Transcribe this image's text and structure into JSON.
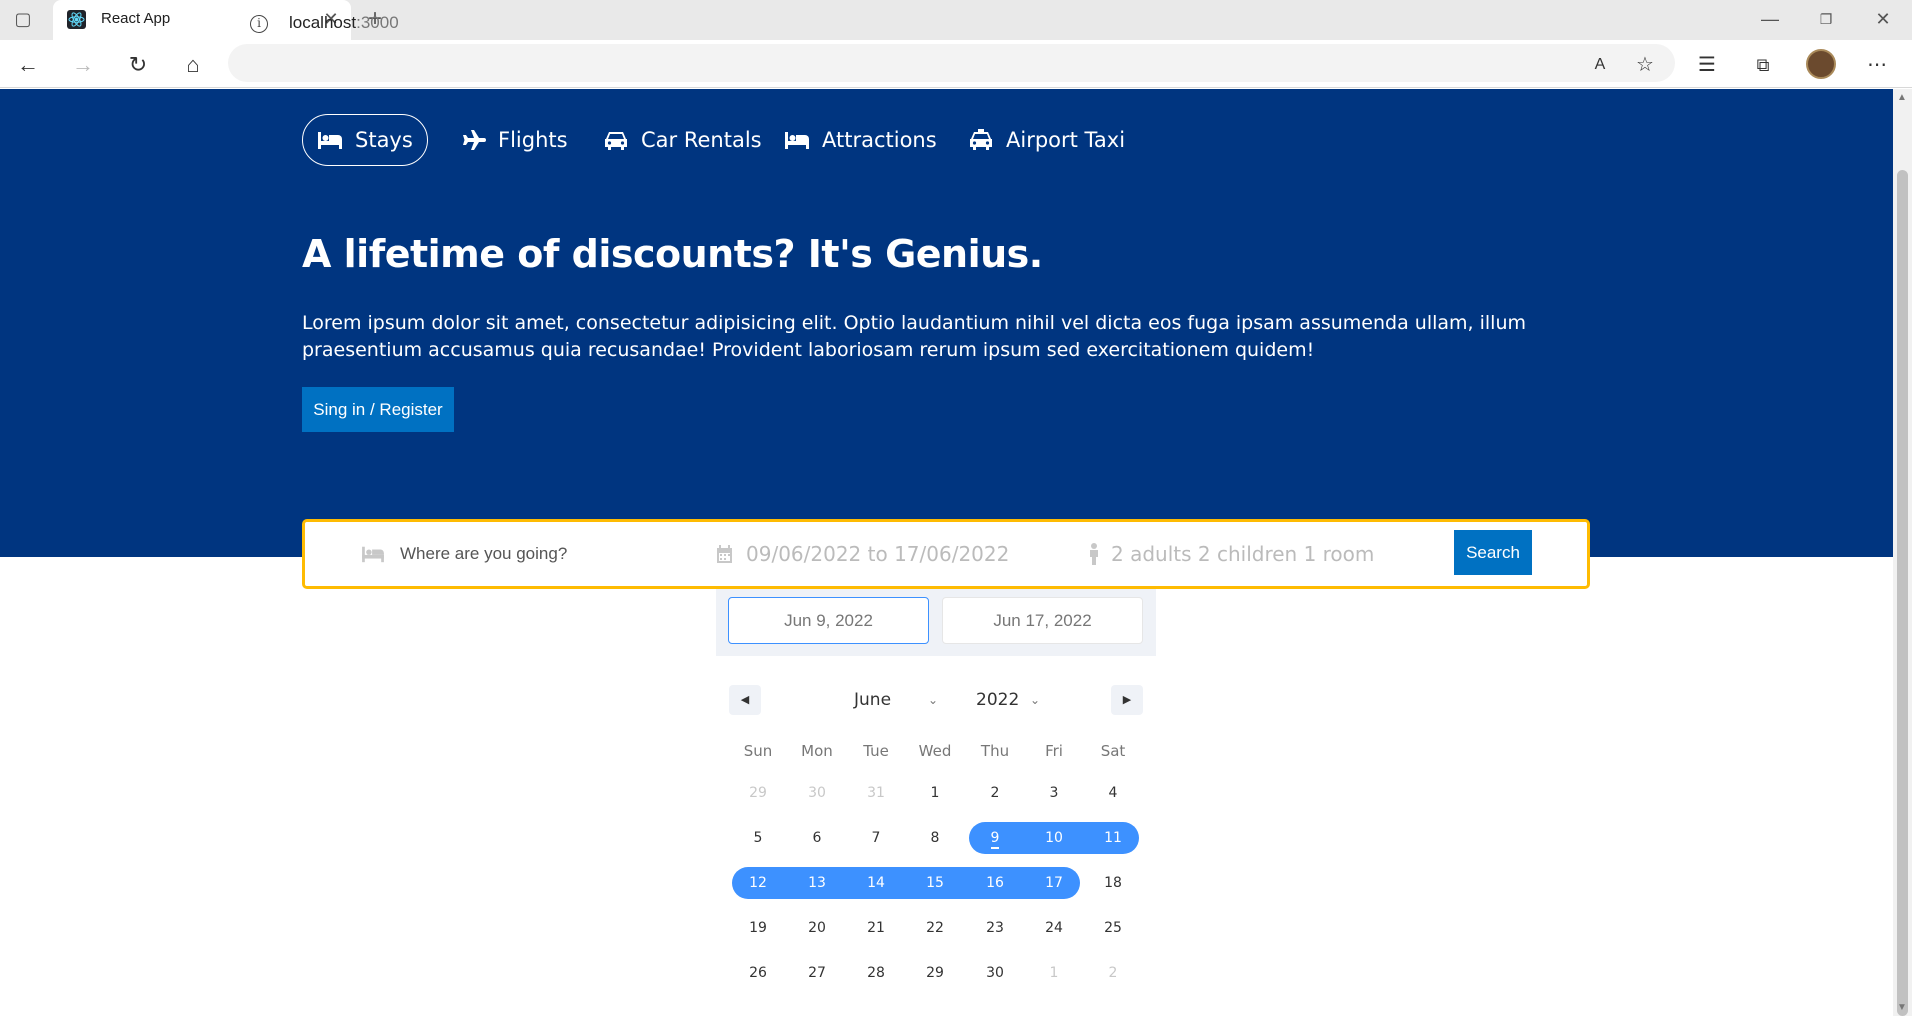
{
  "browser": {
    "tab_title": "React App",
    "url_host": "localhost",
    "url_port": ":3000"
  },
  "nav": {
    "items": [
      {
        "label": "Stays",
        "icon": "bed-icon",
        "active": true
      },
      {
        "label": "Flights",
        "icon": "plane-icon",
        "active": false
      },
      {
        "label": "Car Rentals",
        "icon": "car-icon",
        "active": false
      },
      {
        "label": "Attractions",
        "icon": "bed-icon",
        "active": false
      },
      {
        "label": "Airport Taxi",
        "icon": "taxi-icon",
        "active": false
      }
    ]
  },
  "hero": {
    "title": "A lifetime of discounts? It's Genius.",
    "description": "Lorem ipsum dolor sit amet, consectetur adipisicing elit. Optio laudantium nihil vel dicta eos fuga ipsam assumenda ullam, illum praesentium accusamus quia recusandae! Provident laboriosam rerum ipsum sed exercitationem quidem!",
    "signin_label": "Sing in / Register"
  },
  "search": {
    "destination_placeholder": "Where are you going?",
    "date_range": "09/06/2022 to 17/06/2022",
    "options": "2 adults 2 children 1 room",
    "button_label": "Search"
  },
  "datepicker": {
    "start_display": "Jun 9, 2022",
    "end_display": "Jun 17, 2022",
    "month": "June",
    "year": "2022",
    "weekdays": [
      "Sun",
      "Mon",
      "Tue",
      "Wed",
      "Thu",
      "Fri",
      "Sat"
    ],
    "weeks": [
      [
        "29",
        "30",
        "31",
        "1",
        "2",
        "3",
        "4"
      ],
      [
        "5",
        "6",
        "7",
        "8",
        "9",
        "10",
        "11"
      ],
      [
        "12",
        "13",
        "14",
        "15",
        "16",
        "17",
        "18"
      ],
      [
        "19",
        "20",
        "21",
        "22",
        "23",
        "24",
        "25"
      ],
      [
        "26",
        "27",
        "28",
        "29",
        "30",
        "1",
        "2"
      ]
    ],
    "selected_start_day": 9,
    "selected_end_day": 17,
    "range_color": "#3d91ff"
  },
  "colors": {
    "brand_blue": "#003580",
    "button_blue": "#0071c2",
    "search_border": "#febb02"
  }
}
